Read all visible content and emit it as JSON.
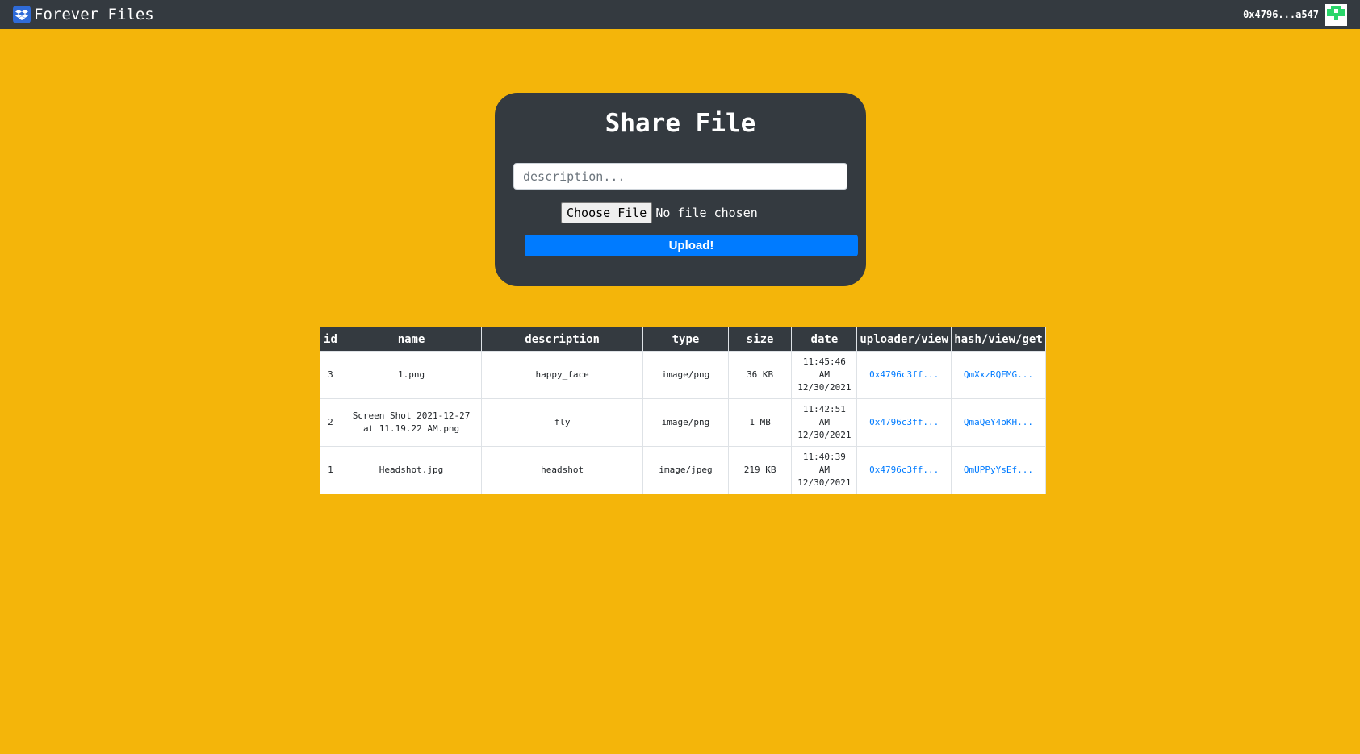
{
  "navbar": {
    "title": "Forever Files",
    "account_address": "0x4796...a547"
  },
  "share_card": {
    "title": "Share File",
    "description_placeholder": "description...",
    "choose_file_label": "Choose File",
    "file_status": "No file chosen",
    "upload_label": "Upload!"
  },
  "table": {
    "headers": {
      "id": "id",
      "name": "name",
      "description": "description",
      "type": "type",
      "size": "size",
      "date": "date",
      "uploader": "uploader/view",
      "hash": "hash/view/get"
    },
    "rows": [
      {
        "id": "3",
        "name": "1.png",
        "description": "happy_face",
        "type": "image/png",
        "size": "36 KB",
        "date_time": "11:45:46",
        "date_ampm": "AM",
        "date_day": "12/30/2021",
        "uploader": "0x4796c3ff...",
        "hash": "QmXxzRQEMG..."
      },
      {
        "id": "2",
        "name": "Screen Shot 2021-12-27 at 11.19.22 AM.png",
        "description": "fly",
        "type": "image/png",
        "size": "1 MB",
        "date_time": "11:42:51",
        "date_ampm": "AM",
        "date_day": "12/30/2021",
        "uploader": "0x4796c3ff...",
        "hash": "QmaQeY4oKH..."
      },
      {
        "id": "1",
        "name": "Headshot.jpg",
        "description": "headshot",
        "type": "image/jpeg",
        "size": "219 KB",
        "date_time": "11:40:39",
        "date_ampm": "AM",
        "date_day": "12/30/2021",
        "uploader": "0x4796c3ff...",
        "hash": "QmUPPyYsEf..."
      }
    ]
  },
  "icons": {
    "logo": "dropbox-logo-icon",
    "avatar": "identicon-avatar"
  },
  "colors": {
    "background": "#f4b50a",
    "navbar": "#343a40",
    "accent": "#007bff",
    "avatar_fill": "#2ad66a"
  }
}
